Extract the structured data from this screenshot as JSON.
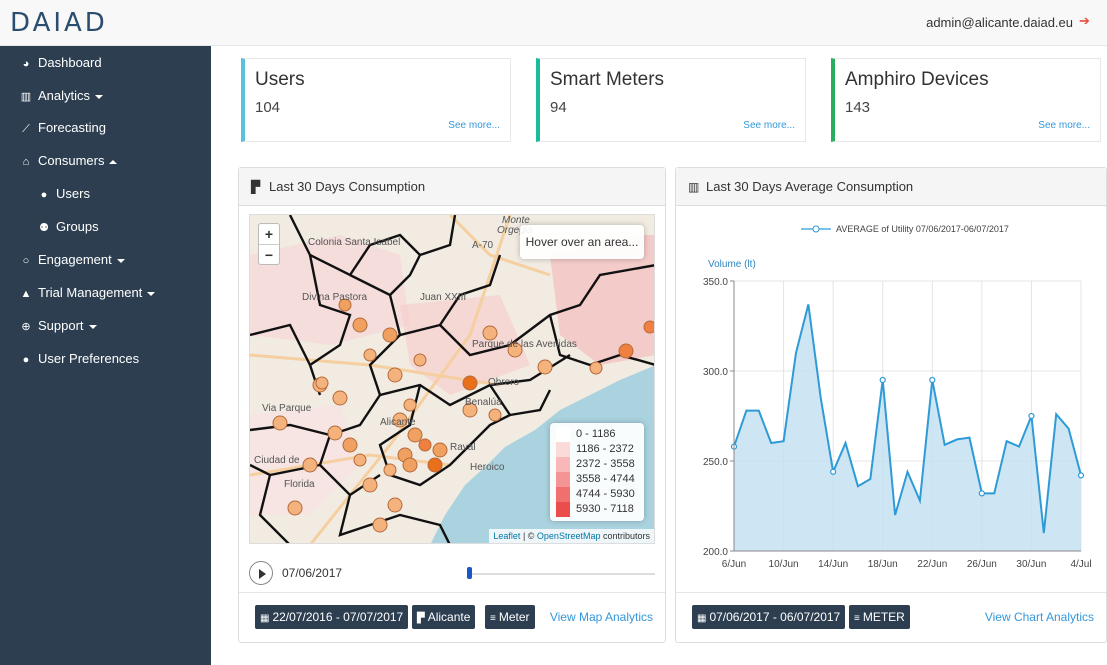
{
  "app": {
    "logo": "DAIAD",
    "user_email": "admin@alicante.daiad.eu"
  },
  "sidebar": {
    "items": [
      {
        "label": "Dashboard",
        "icon": "dashboard-icon"
      },
      {
        "label": "Analytics",
        "icon": "bar-chart-icon",
        "caret": "down"
      },
      {
        "label": "Forecasting",
        "icon": "line-chart-icon"
      },
      {
        "label": "Consumers",
        "icon": "home-icon",
        "caret": "up"
      },
      {
        "label": "Users",
        "icon": "user-icon",
        "sub": true
      },
      {
        "label": "Groups",
        "icon": "group-icon",
        "sub": true
      },
      {
        "label": "Engagement",
        "icon": "comment-icon",
        "caret": "down"
      },
      {
        "label": "Trial Management",
        "icon": "flask-icon",
        "caret": "down"
      },
      {
        "label": "Support",
        "icon": "lifebuoy-icon",
        "caret": "down"
      },
      {
        "label": "User Preferences",
        "icon": "user-icon"
      }
    ]
  },
  "cards": [
    {
      "title": "Users",
      "value": "104",
      "more": "See more...",
      "color": "#5bc0de"
    },
    {
      "title": "Smart Meters",
      "value": "94",
      "more": "See more...",
      "color": "#1abc9c"
    },
    {
      "title": "Amphiro Devices",
      "value": "143",
      "more": "See more...",
      "color": "#27ae60"
    }
  ],
  "map_panel": {
    "title": "Last 30 Days Consumption",
    "hover_text": "Hover over an area...",
    "zoom_in": "+",
    "zoom_out": "−",
    "legend": [
      {
        "label": "0 - 1186",
        "color": "#ffffff"
      },
      {
        "label": "1186 - 2372",
        "color": "#fbdada"
      },
      {
        "label": "2372 - 3558",
        "color": "#f8b8b8"
      },
      {
        "label": "3558 - 4744",
        "color": "#f49494"
      },
      {
        "label": "4744 - 5930",
        "color": "#f07070"
      },
      {
        "label": "5930 - 7118",
        "color": "#eb4d4d"
      }
    ],
    "attribution": {
      "leaflet": "Leaflet",
      "sep": " | © ",
      "osm": "OpenStreetMap",
      "rest": " contributors"
    },
    "map_labels": [
      "Colonia Santa Isabel",
      "Divina Pastora",
      "Juan XXIII",
      "Parque de las Avenidas",
      "Obrero",
      "Via Parque",
      "Alicante",
      "Ciudad de",
      "Florida",
      "Raval",
      "Benalúa",
      "Heroico",
      "A-70",
      "Orgegia",
      "Monte"
    ],
    "play_date": "07/06/2017",
    "slider_fraction": 0.0,
    "footer": {
      "range": "22/07/2016 - 07/07/2017",
      "area": "Alicante",
      "source": "Meter",
      "link": "View Map Analytics"
    }
  },
  "chart_panel": {
    "title": "Last 30 Days Average Consumption",
    "footer": {
      "range": "07/06/2017 - 06/07/2017",
      "source": "METER",
      "link": "View Chart Analytics"
    }
  },
  "chart_data": {
    "type": "area",
    "series": [
      {
        "name": "AVERAGE of Utility 07/06/2017-06/07/2017",
        "values": [
          258,
          278,
          278,
          260,
          261,
          310,
          337,
          285,
          244,
          260,
          236,
          240,
          295,
          220,
          244,
          228,
          295,
          259,
          262,
          263,
          232,
          232,
          261,
          258,
          275,
          210,
          276,
          268,
          242
        ]
      }
    ],
    "x": [
      "6/Jun",
      "7/Jun",
      "8/Jun",
      "9/Jun",
      "10/Jun",
      "11/Jun",
      "12/Jun",
      "13/Jun",
      "14/Jun",
      "15/Jun",
      "16/Jun",
      "17/Jun",
      "18/Jun",
      "19/Jun",
      "20/Jun",
      "21/Jun",
      "22/Jun",
      "23/Jun",
      "24/Jun",
      "25/Jun",
      "26/Jun",
      "27/Jun",
      "28/Jun",
      "29/Jun",
      "30/Jun",
      "1/Jul",
      "2/Jul",
      "3/Jul",
      "4/Jul"
    ],
    "xticks": [
      "6/Jun",
      "10/Jun",
      "14/Jun",
      "18/Jun",
      "22/Jun",
      "26/Jun",
      "30/Jun",
      "4/Jul"
    ],
    "ylabel": "Volume (lt)",
    "ylim": [
      200,
      350
    ],
    "yticks": [
      "200.0",
      "250.0",
      "300.0",
      "350.0"
    ],
    "legend_position": "top-center",
    "highlighted_points": [
      0,
      8,
      12,
      16,
      20,
      24,
      28
    ],
    "colors": {
      "line": "#2e9bd6",
      "fill": "#c6e1f2"
    }
  }
}
